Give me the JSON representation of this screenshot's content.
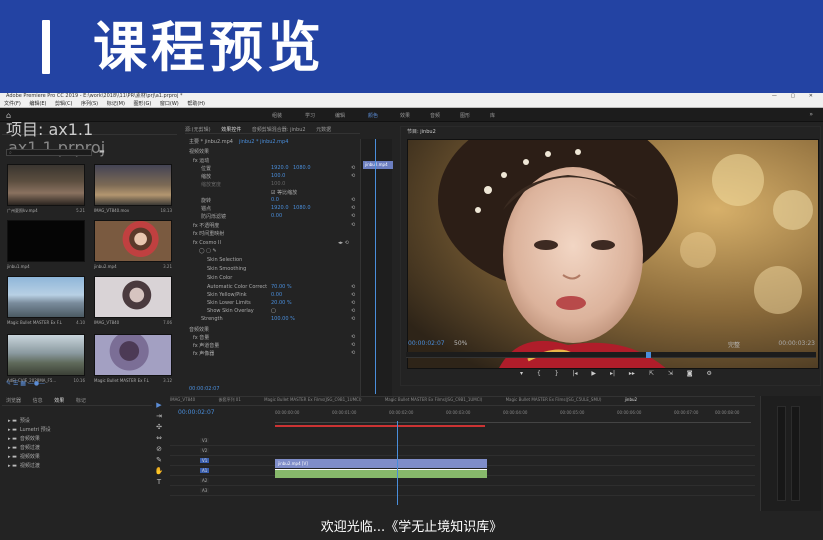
{
  "banner": {
    "title": "课程预览"
  },
  "window": {
    "title": "Adobe Premiere Pro CC 2019 - E:\\work\\2018\\\\11\\PR\\素材\\prj\\a1.prproj *"
  },
  "menu": [
    "文件(F)",
    "编辑(E)",
    "剪辑(C)",
    "序列(S)",
    "标记(M)",
    "图形(G)",
    "窗口(W)",
    "帮助(H)"
  ],
  "workspaces": [
    "组装",
    "学习",
    "编辑",
    "颜色",
    "效果",
    "音频",
    "图形",
    "库"
  ],
  "project": {
    "header": "项目: ax1.1",
    "file": "ax1.1.prproj",
    "search_placeholder": "",
    "items": [
      {
        "name": "广州夏照kv.mp4",
        "dur": "5.21"
      },
      {
        "name": "IMAG_VT840.mov",
        "dur": "18.13"
      },
      {
        "name": "jinbu1.mp4",
        "dur": ""
      },
      {
        "name": "jinbu2.mp4",
        "dur": "3.21"
      },
      {
        "name": "Magic Bullet MASTER Ex F.L",
        "dur": "4.10"
      },
      {
        "name": "IMAG_VT840",
        "dur": "7.06"
      },
      {
        "name": "AdEJ_CVIE_2028MA_F5...",
        "dur": "10.16"
      },
      {
        "name": "Magic Bullet MASTER Ex F.L",
        "dur": "3.12"
      }
    ]
  },
  "effects": {
    "tabs": [
      "源:(无剪辑)",
      "效果控件",
      "音频剪辑混合器: jinbu2",
      "元数据"
    ],
    "source": "主要 * jinbu2.mp4",
    "seq": "jinbu2 * jinbu2.mp4",
    "section": "视频效果",
    "rows": [
      {
        "label": "fx 运动",
        "v": "",
        "v2": ""
      },
      {
        "label": "位置",
        "v": "1920.0",
        "v2": "1080.0"
      },
      {
        "label": "缩放",
        "v": "100.0",
        "v2": ""
      },
      {
        "label": "缩放宽度",
        "v": "100.0",
        "v2": ""
      },
      {
        "label": "等比缩放",
        "v": "",
        "v2": ""
      },
      {
        "label": "旋转",
        "v": "0.0",
        "v2": ""
      },
      {
        "label": "锚点",
        "v": "1920.0",
        "v2": "1080.0"
      },
      {
        "label": "防闪烁滤镜",
        "v": "0.00",
        "v2": ""
      },
      {
        "label": "fx 不透明度",
        "v": "",
        "v2": ""
      },
      {
        "label": "fx 时间重映射",
        "v": "",
        "v2": ""
      },
      {
        "label": "fx Cosmo II",
        "v": "",
        "v2": ""
      },
      {
        "label": "Skin Selection",
        "v": "",
        "v2": ""
      },
      {
        "label": "Skin Smoothing",
        "v": "",
        "v2": ""
      },
      {
        "label": "Skin Color",
        "v": "",
        "v2": ""
      },
      {
        "label": "Automatic Color Correct",
        "v": "70.00 %",
        "v2": ""
      },
      {
        "label": "Skin Yellow/Pink",
        "v": "0.00",
        "v2": ""
      },
      {
        "label": "Skin Lower Limits",
        "v": "20.00 %",
        "v2": ""
      },
      {
        "label": "Show Skin Overlay",
        "v": "",
        "v2": ""
      },
      {
        "label": "Strength",
        "v": "100.00 %",
        "v2": ""
      },
      {
        "label": "音频效果",
        "v": "",
        "v2": ""
      },
      {
        "label": "fx 音量",
        "v": "",
        "v2": ""
      },
      {
        "label": "fx 声道音量",
        "v": "",
        "v2": ""
      },
      {
        "label": "fx 声像器",
        "v": "",
        "v2": ""
      }
    ],
    "timecode": "00:00:02:07",
    "mini_clip": "jinbu2.mp4"
  },
  "program": {
    "tab": "节目: jinbu2",
    "timecode": "00:00:02:07",
    "fit": "50%",
    "quality": "完整",
    "duration": "00:00:03:23"
  },
  "media": {
    "tabs": [
      "浏览器",
      "信息",
      "效果",
      "标记"
    ],
    "items": [
      "预设",
      "Lumetri 预设",
      "音频效果",
      "音频过渡",
      "视频效果",
      "视频过渡"
    ]
  },
  "tools": [
    "▶",
    "⇥",
    "✣",
    "⇔",
    "⊘",
    "✎",
    "✋",
    "T"
  ],
  "timeline": {
    "tabs": [
      "IMAG_VT840",
      "嵌套序列 01",
      "Magic Bullet MASTER Ex Films(JSG_C9B1_1UMCI)",
      "Magic Bullet MASTER Ex Films(JSG_C9B1_1UMCI)",
      "Magic Bullet MASTER Ex Films(JSG_C5ULE_SMU)",
      "jinbu2"
    ],
    "timecode": "00:00:02:07",
    "ruler": [
      "00:00:00:00",
      "00:00:01:00",
      "00:00:02:00",
      "00:00:03:00",
      "00:00:04:00",
      "00:00:05:00",
      "00:00:06:00",
      "00:00:07:00",
      "00:00:08:00"
    ],
    "tracks": [
      "V3",
      "V2",
      "V1",
      "A1",
      "A2",
      "A3"
    ],
    "clip": "jinbu2.mp4 [V]"
  },
  "subtitle": "欢迎光临...《学无止境知识库》",
  "colors": {
    "banner": "#2343a3",
    "accent": "#4a8edb"
  }
}
